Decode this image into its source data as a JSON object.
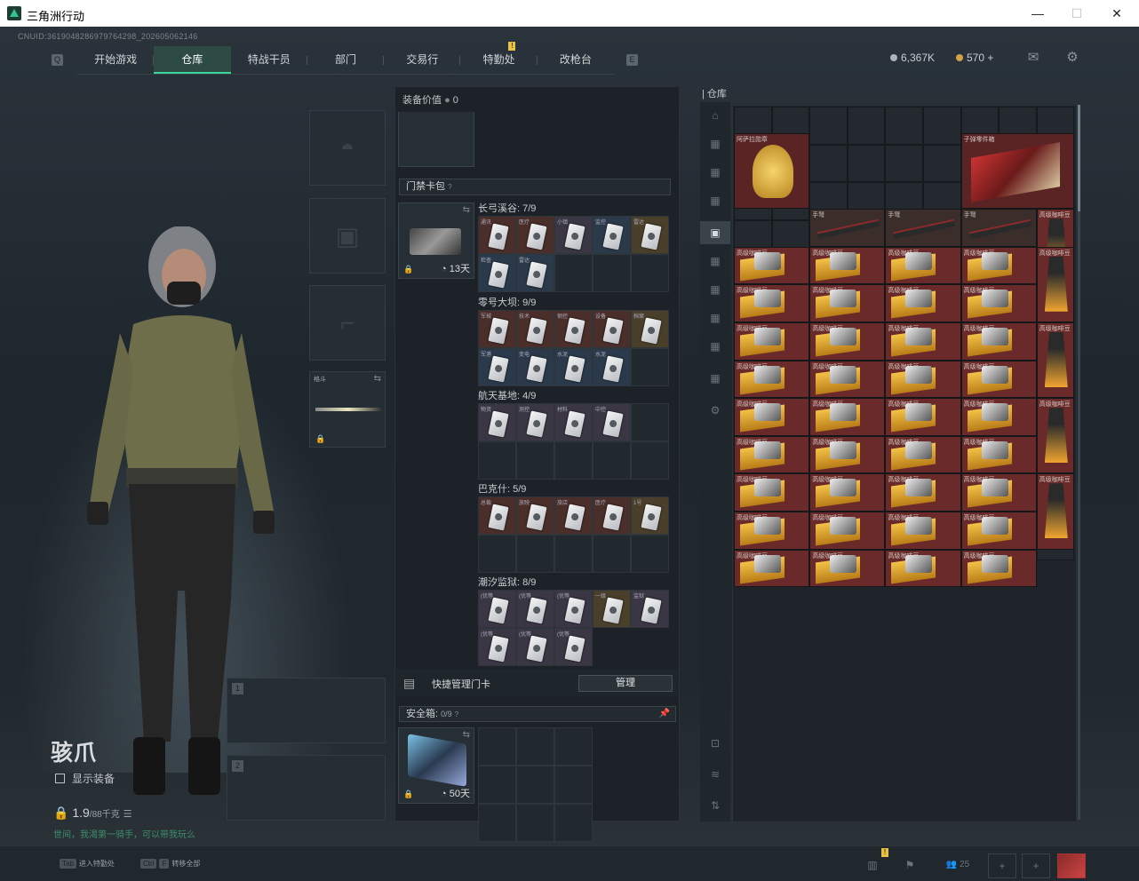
{
  "window": {
    "title": "三角洲行动"
  },
  "uid": "CNUID:3619048286979764298_202605062146",
  "nav": {
    "tabs": [
      "开始游戏",
      "仓库",
      "特战干员",
      "部门",
      "交易行",
      "特勤处",
      "改枪台"
    ],
    "active": "仓库"
  },
  "currency": {
    "havoc": "6,367K",
    "coins": "570",
    "plus": "+"
  },
  "operator": {
    "name": "骇爪",
    "show_equipment": "显示装备",
    "weight": "1.9",
    "weight_max": "/88千克",
    "tip": "世间，我渴第一骑手，可以带我玩么"
  },
  "equipment": {
    "value_label": "装备价值",
    "value": "0"
  },
  "keycard_pack": {
    "title": "门禁卡包",
    "timer": "13天",
    "groups": [
      {
        "name": "长弓溪谷: 7/9",
        "labels": [
          "通讯",
          "医疗",
          "小镇",
          "监控",
          "雷达",
          "检查",
          "雷达"
        ]
      },
      {
        "name": "零号大坝: 9/9",
        "labels": [
          "军械",
          "技术",
          "钢控",
          "设备",
          "档案",
          "军港",
          "变电",
          "水泥",
          "水泥"
        ]
      },
      {
        "name": "航天基地: 4/9",
        "labels": [
          "物资",
          "测控",
          "材料",
          "中控"
        ]
      },
      {
        "name": "巴克什: 5/9",
        "labels": [
          "总裁",
          "放映",
          "旅店",
          "医疗",
          "1号"
        ]
      },
      {
        "name": "潮汐监狱: 8/9",
        "labels": [
          "(优等",
          "(优等",
          "(优等",
          "一级",
          "监狱",
          "(优等",
          "(优等",
          "(优等"
        ]
      }
    ]
  },
  "quick_manage": {
    "label": "快捷管理门卡",
    "button": "管理"
  },
  "safe_box": {
    "label": "安全箱:",
    "count": "0/9",
    "timer": "50天"
  },
  "warehouse": {
    "title": "仓库",
    "items": {
      "medal": "阿萨拉勋章",
      "crate": "子弹零件箱",
      "crossbow": "手弩",
      "coffee": "高级咖啡豆",
      "bag": "高级咖啡豆"
    }
  },
  "weapon_slots": [
    {
      "num": "1"
    },
    {
      "num": "2"
    }
  ],
  "melee_slot": {
    "label": "格斗"
  },
  "bottom": {
    "tab_key": "Tab",
    "tab_label": "进入特勤处",
    "ctrl_key": "Ctrl",
    "f_key": "F",
    "ctrl_label": "转移全部",
    "friends": "25"
  },
  "colors": {
    "accent": "#3ad79a",
    "cell_red": "#6a2a2a",
    "badge": "#e8c246"
  }
}
